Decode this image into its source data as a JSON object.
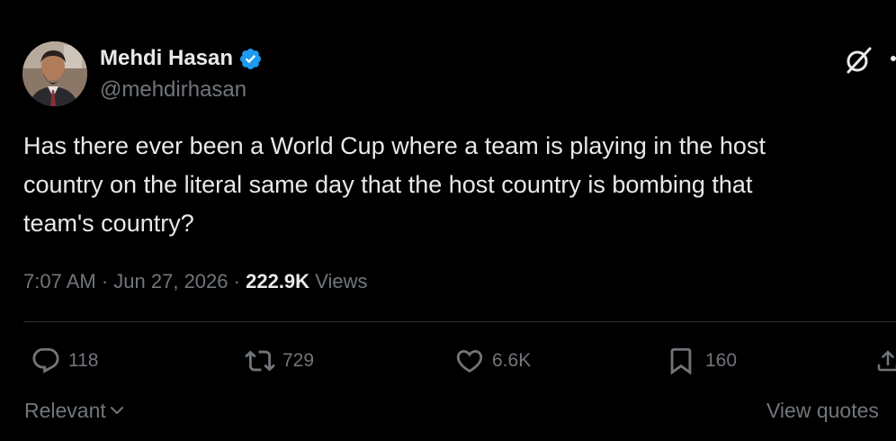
{
  "author": {
    "display_name": "Mehdi Hasan",
    "handle": "@mehdirhasan",
    "verified": true
  },
  "tweet": {
    "text": "Has there ever been a World Cup where a team is playing in the host\ncountry on the literal same day that the host country is bombing that\nteam's country?",
    "time": "7:07 AM",
    "separator": "·",
    "date": "Jun 27, 2026",
    "views_count": "222.9K",
    "views_label": "Views"
  },
  "actions": {
    "replies": "118",
    "reposts": "729",
    "likes": "6.6K",
    "bookmarks": "160"
  },
  "footer": {
    "sort_label": "Relevant",
    "view_quotes_label": "View quotes"
  },
  "icons": {
    "verified": "verified-badge-icon",
    "grok": "grok-icon",
    "more": "more-options-icon",
    "reply": "reply-icon",
    "repost": "repost-icon",
    "like": "heart-icon",
    "bookmark": "bookmark-icon",
    "share": "share-icon",
    "chevron": "chevron-down-icon"
  },
  "colors": {
    "background": "#000000",
    "primary_text": "#e7e9ea",
    "secondary_text": "#71767b",
    "verified_blue": "#1d9bf0",
    "divider": "#2f3336"
  }
}
